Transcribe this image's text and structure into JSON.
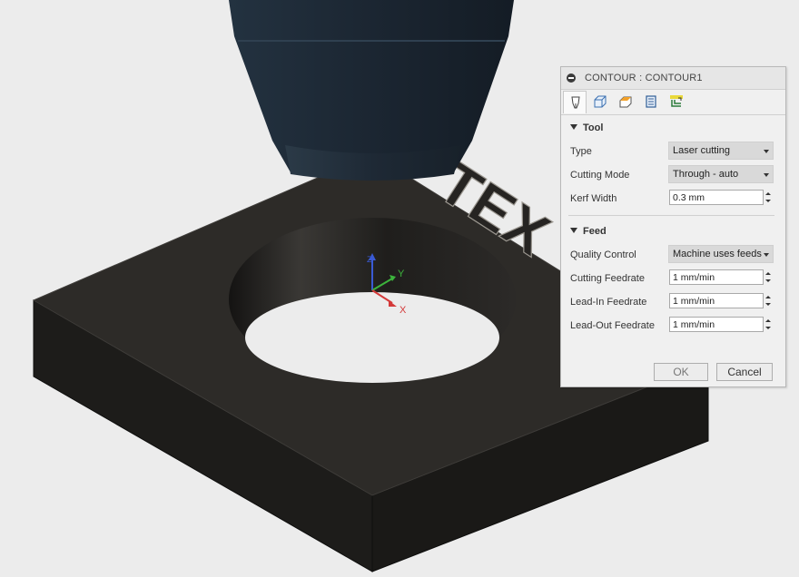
{
  "dialog": {
    "title": "CONTOUR : CONTOUR1",
    "tab_icons": [
      "tool-tab-icon",
      "geometry-tab-icon",
      "heights-tab-icon",
      "passes-tab-icon",
      "linking-tab-icon"
    ],
    "tool_section": {
      "header": "Tool",
      "type_label": "Type",
      "type_value": "Laser cutting",
      "cutting_mode_label": "Cutting Mode",
      "cutting_mode_value": "Through - auto",
      "kerf_width_label": "Kerf Width",
      "kerf_width_value": "0.3 mm"
    },
    "feed_section": {
      "header": "Feed",
      "quality_control_label": "Quality Control",
      "quality_control_value": "Machine uses feeds",
      "cutting_feedrate_label": "Cutting Feedrate",
      "cutting_feedrate_value": "1 mm/min",
      "lead_in_feedrate_label": "Lead-In Feedrate",
      "lead_in_feedrate_value": "1 mm/min",
      "lead_out_feedrate_label": "Lead-Out Feedrate",
      "lead_out_feedrate_value": "1 mm/min"
    },
    "ok_label": "OK",
    "cancel_label": "Cancel"
  },
  "viewport": {
    "model_text": "TEX",
    "axis_x": "X",
    "axis_y": "Y",
    "axis_z": "Z"
  },
  "colors": {
    "background": "#ececec",
    "stock_top": "#2b2926",
    "stock_side": "#1a1917",
    "tool_head": "#1e2a35",
    "axis_x": "#d43a3a",
    "axis_y": "#3cb43c",
    "axis_z": "#3a5ad4"
  }
}
